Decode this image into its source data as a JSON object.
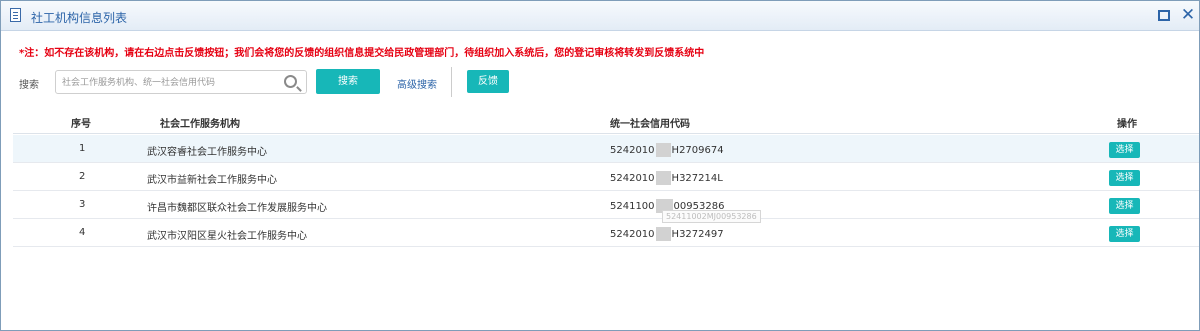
{
  "window": {
    "title": "社工机构信息列表"
  },
  "notice": "*注：如不存在该机构，请在右边点击反馈按钮；我们会将您的反馈的组织信息提交给民政管理部门，待组织加入系统后，您的登记审核将转发到反馈系统中",
  "search": {
    "label": "搜索",
    "placeholder": "社会工作服务机构、统一社会信用代码",
    "value": "",
    "button_label": "搜索",
    "advanced_label": "高级搜索",
    "feedback_label": "反馈"
  },
  "table": {
    "headers": {
      "index": "序号",
      "org": "社会工作服务机构",
      "code": "统一社会信用代码",
      "action": "操作"
    },
    "rows": [
      {
        "index": "1",
        "org": "武汉容睿社会工作服务中心",
        "code_prefix": "5242010",
        "code_suffix": "H2709674",
        "action": "选择"
      },
      {
        "index": "2",
        "org": "武汉市益新社会工作服务中心",
        "code_prefix": "5242010",
        "code_suffix": "H327214L",
        "action": "选择"
      },
      {
        "index": "3",
        "org": "许昌市魏都区联众社会工作发展服务中心",
        "code_prefix": "5241100",
        "code_suffix": "00953286",
        "action": "选择"
      },
      {
        "index": "4",
        "org": "武汉市汉阳区星火社会工作服务中心",
        "code_prefix": "5242010",
        "code_suffix": "H3272497",
        "action": "选择"
      }
    ]
  },
  "tooltip": "52411002MJ00953286",
  "colors": {
    "accent": "#17b7b8",
    "title": "#2c64a8",
    "notice": "#e60012",
    "row_alt": "#eef6fb"
  }
}
